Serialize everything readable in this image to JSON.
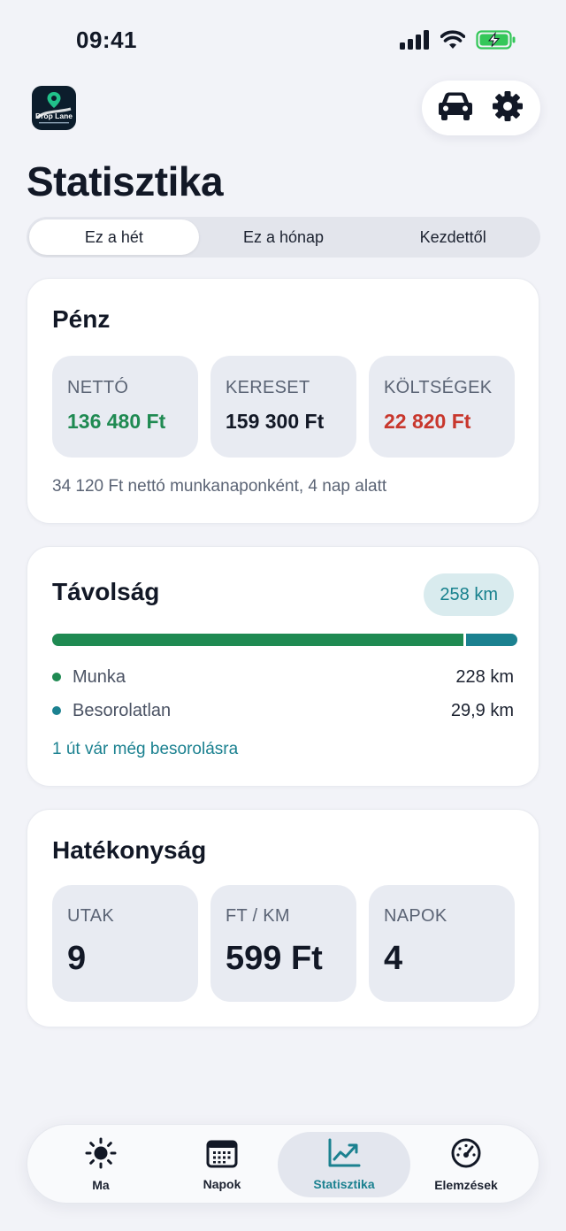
{
  "status_bar": {
    "time": "09:41"
  },
  "header": {
    "logo_text": "Drop Lane",
    "title": "Statisztika"
  },
  "segments": [
    {
      "label": "Ez a hét",
      "active": true
    },
    {
      "label": "Ez a hónap",
      "active": false
    },
    {
      "label": "Kezdettől",
      "active": false
    }
  ],
  "money": {
    "title": "Pénz",
    "net": {
      "label": "NETTÓ",
      "value": "136 480 Ft",
      "color": "#1f8a52"
    },
    "earned": {
      "label": "KERESET",
      "value": "159 300 Ft",
      "color": "#121826"
    },
    "costs": {
      "label": "KÖLTSÉGEK",
      "value": "22 820 Ft",
      "color": "#c8372d"
    },
    "note": "34 120 Ft nettó munkanaponként, 4 nap alatt"
  },
  "distance": {
    "title": "Távolság",
    "total": "258 km",
    "work_fraction": 0.884,
    "legend": [
      {
        "label": "Munka",
        "value": "228 km",
        "color": "#1f8a52"
      },
      {
        "label": "Besorolatlan",
        "value": "29,9 km",
        "color": "#1b8190"
      }
    ],
    "pending_link": "1 út vár még besorolásra"
  },
  "efficiency": {
    "title": "Hatékonyság",
    "trips": {
      "label": "UTAK",
      "value": "9"
    },
    "per_km": {
      "label": "FT / KM",
      "value": "599 Ft"
    },
    "days": {
      "label": "NAPOK",
      "value": "4"
    }
  },
  "nav": {
    "items": [
      {
        "label": "Ma",
        "icon": "sun-icon"
      },
      {
        "label": "Napok",
        "icon": "calendar-icon"
      },
      {
        "label": "Statisztika",
        "icon": "chart-icon",
        "active": true
      },
      {
        "label": "Elemzések",
        "icon": "speedometer-icon"
      }
    ]
  },
  "colors": {
    "accent": "#1b8190",
    "positive": "#1f8a52",
    "negative": "#c8372d"
  }
}
